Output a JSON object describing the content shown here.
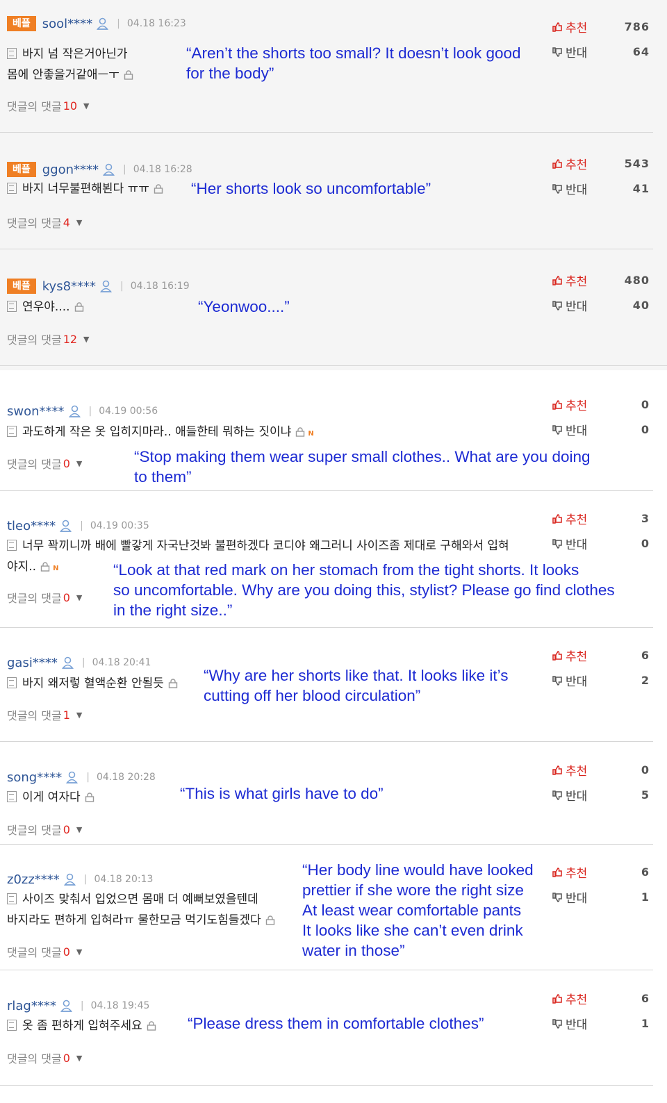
{
  "labels": {
    "best_badge": "베플",
    "recommend": "추천",
    "oppose": "반대",
    "replies": "댓글의 댓글"
  },
  "comments": [
    {
      "user": "sool****",
      "date": "04.18 16:23",
      "best": true,
      "text": [
        "바지 넘 작은거아닌가",
        "몸에 안좋을거같애ㅡㅜ"
      ],
      "replies": "10",
      "up": "786",
      "down": "64",
      "translation": [
        "“Aren’t the shorts too small? It doesn’t look good",
        "for the body”"
      ]
    },
    {
      "user": "ggon****",
      "date": "04.18 16:28",
      "best": true,
      "text": [
        "바지 너무불편해뵌다 ㅠㅠ"
      ],
      "replies": "4",
      "up": "543",
      "down": "41",
      "translation": [
        "“Her shorts look so uncomfortable”"
      ]
    },
    {
      "user": "kys8****",
      "date": "04.18 16:19",
      "best": true,
      "text": [
        "연우야...."
      ],
      "replies": "12",
      "up": "480",
      "down": "40",
      "translation": [
        "“Yeonwoo....”"
      ]
    },
    {
      "user": "swon****",
      "date": "04.19 00:56",
      "best": false,
      "text": [
        "과도하게 작은 옷 입히지마라.. 애들한테 뭐하는 짓이냐"
      ],
      "replies": "0",
      "up": "0",
      "down": "0",
      "translation": [
        "“Stop making them wear super small clothes.. What are you doing",
        "to them”"
      ]
    },
    {
      "user": "tleo****",
      "date": "04.19 00:35",
      "best": false,
      "text": [
        "너무 꽉끼니까 배에 빨갛게 자국난것봐 불편하겠다 코디야 왜그러니 사이즈좀 제대로 구해와서 입혀",
        "야지.."
      ],
      "replies": "0",
      "up": "3",
      "down": "0",
      "translation": [
        "“Look at that red mark on her stomach from the tight shorts. It looks",
        "so uncomfortable. Why are you doing this, stylist? Please go find clothes",
        "in the right size..”"
      ]
    },
    {
      "user": "gasi****",
      "date": "04.18 20:41",
      "best": false,
      "text": [
        "바지 왜저렇 혈액순환 안될듯"
      ],
      "replies": "1",
      "up": "6",
      "down": "2",
      "translation": [
        "“Why are her shorts like that. It looks like it’s",
        "cutting off her blood circulation”"
      ]
    },
    {
      "user": "song****",
      "date": "04.18 20:28",
      "best": false,
      "text": [
        "이게 여자다"
      ],
      "replies": "0",
      "up": "0",
      "down": "5",
      "translation": [
        "“This is what girls have to do”"
      ]
    },
    {
      "user": "z0zz****",
      "date": "04.18 20:13",
      "best": false,
      "text": [
        "사이즈 맞춰서 입었으면 몸매 더 예뻐보였을텐데",
        "바지라도 편하게 입혀라ㅠ 물한모금 먹기도힘들겠다"
      ],
      "replies": "0",
      "up": "6",
      "down": "1",
      "translation": [
        "“Her body line would have looked",
        "prettier if she wore the right size",
        "At least wear comfortable pants",
        "It looks like she can’t even drink",
        "water in those”"
      ]
    },
    {
      "user": "rlag****",
      "date": "04.18 19:45",
      "best": false,
      "text": [
        "옷 좀 편하게 입혀주세요"
      ],
      "replies": "0",
      "up": "6",
      "down": "1",
      "translation": [
        "“Please dress them in comfortable clothes”"
      ]
    }
  ]
}
